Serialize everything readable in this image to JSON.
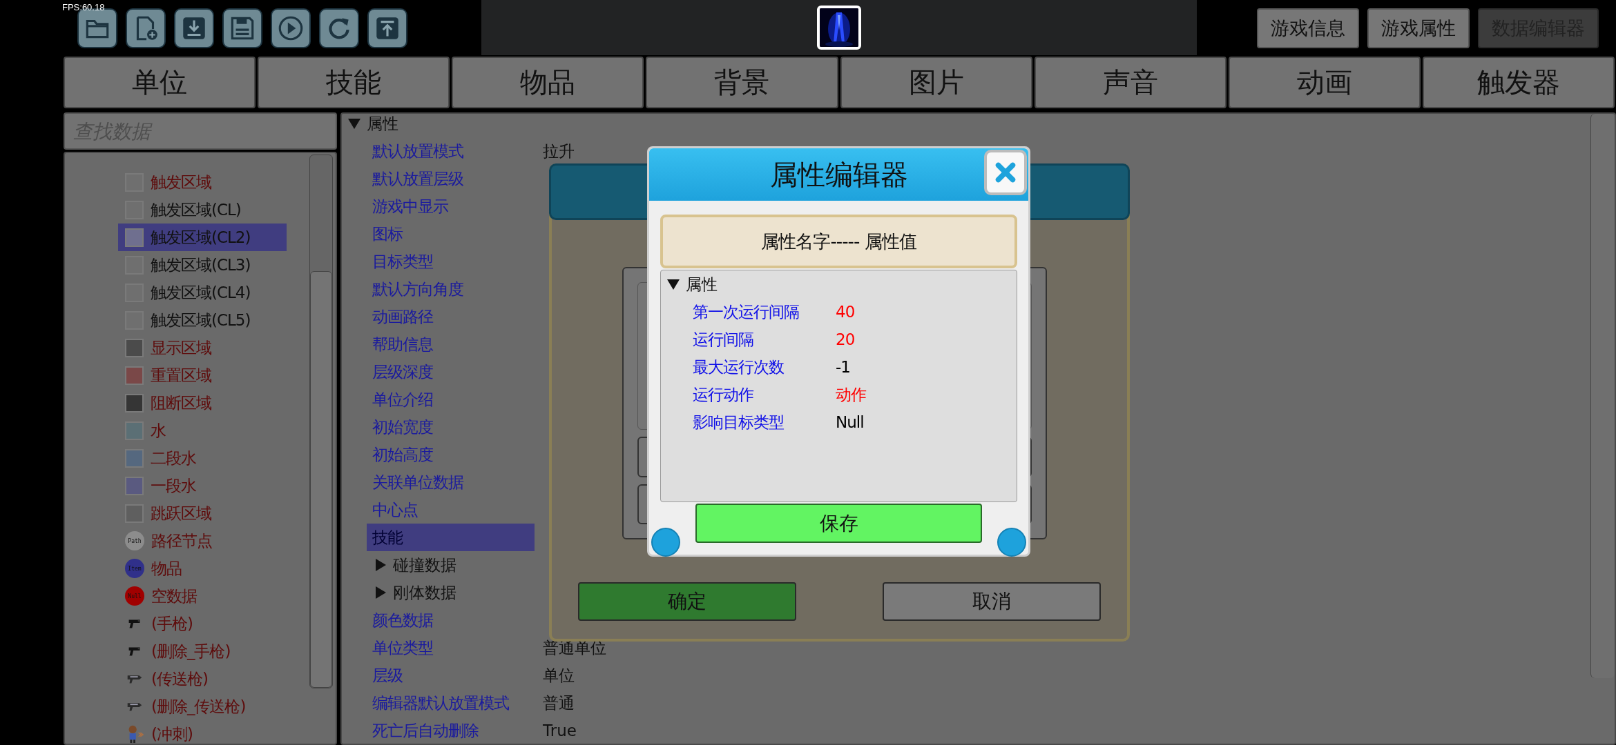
{
  "fps": "FPS:60.18",
  "top_buttons": [
    {
      "label": "游戏信息",
      "selected": false
    },
    {
      "label": "游戏属性",
      "selected": false
    },
    {
      "label": "数据编辑器",
      "selected": true
    }
  ],
  "tabs": [
    {
      "label": "单位"
    },
    {
      "label": "技能"
    },
    {
      "label": "物品"
    },
    {
      "label": "背景"
    },
    {
      "label": "图片"
    },
    {
      "label": "声音"
    },
    {
      "label": "动画"
    },
    {
      "label": "触发器"
    }
  ],
  "search": {
    "placeholder": "查找数据"
  },
  "data_list": [
    {
      "label": "触发区域",
      "kind": "swatch",
      "swatch": {
        "color": "#6f6f6f"
      },
      "color": "#5e0c0c",
      "selected": false
    },
    {
      "label": "触发区域(CL)",
      "kind": "swatch",
      "swatch": {
        "color": "#6f6f6f"
      },
      "color": "#111111",
      "selected": false
    },
    {
      "label": "触发区域(CL2)",
      "kind": "swatch",
      "swatch": {
        "color": "#6f6f8f"
      },
      "color": "#111111",
      "selected": true
    },
    {
      "label": "触发区域(CL3)",
      "kind": "swatch",
      "swatch": {
        "color": "#6f6f6f"
      },
      "color": "#111111",
      "selected": false
    },
    {
      "label": "触发区域(CL4)",
      "kind": "swatch",
      "swatch": {
        "color": "#6f6f6f"
      },
      "color": "#111111",
      "selected": false
    },
    {
      "label": "触发区域(CL5)",
      "kind": "swatch",
      "swatch": {
        "color": "#6f6f6f"
      },
      "color": "#111111",
      "selected": false
    },
    {
      "label": "显示区域",
      "kind": "swatch",
      "swatch": {
        "color": "#4b4b4b"
      },
      "color": "#5e0c0c",
      "selected": false
    },
    {
      "label": "重置区域",
      "kind": "swatch",
      "swatch": {
        "color": "#7a4848"
      },
      "color": "#5e0c0c",
      "selected": false
    },
    {
      "label": "阻断区域",
      "kind": "swatch",
      "swatch": {
        "color": "#353535"
      },
      "color": "#5e0c0c",
      "selected": false
    },
    {
      "label": "水",
      "kind": "swatch",
      "swatch": {
        "color": "#5b6f75"
      },
      "color": "#5e0c0c",
      "selected": false
    },
    {
      "label": "二段水",
      "kind": "swatch",
      "swatch": {
        "color": "#55687f"
      },
      "color": "#5e0c0c",
      "selected": false
    },
    {
      "label": "一段水",
      "kind": "swatch",
      "swatch": {
        "color": "#5a5a80"
      },
      "color": "#5e0c0c",
      "selected": false
    },
    {
      "label": "跳跃区域",
      "kind": "swatch",
      "swatch": {
        "color": "#5f5f5f"
      },
      "color": "#5e0c0c",
      "selected": false
    },
    {
      "label": "路径节点",
      "kind": "badge",
      "badge": {
        "label": "Path",
        "color": "#8c8c8c"
      },
      "color": "#5e0c0c",
      "selected": false
    },
    {
      "label": "物品",
      "kind": "badge",
      "badge": {
        "label": "Item",
        "color": "#30308a"
      },
      "color": "#5e0c0c",
      "selected": false
    },
    {
      "label": "空数据",
      "kind": "badge",
      "badge": {
        "label": "Null",
        "color": "#a00000"
      },
      "color": "#5e0c0c",
      "selected": false
    },
    {
      "label": "(手枪)",
      "kind": "pistol",
      "color": "#5e0c0c",
      "selected": false
    },
    {
      "label": "(删除_手枪)",
      "kind": "pistol",
      "color": "#5e0c0c",
      "selected": false
    },
    {
      "label": "(传送枪)",
      "kind": "blaster",
      "color": "#5e0c0c",
      "selected": false
    },
    {
      "label": "(删除_传送枪)",
      "kind": "blaster",
      "color": "#5e0c0c",
      "selected": false
    },
    {
      "label": "(冲刺)",
      "kind": "figure",
      "color": "#5e0c0c",
      "selected": false
    }
  ],
  "properties": {
    "label": "属性",
    "expanded": true,
    "items": [
      {
        "kind": "field",
        "label": "默认放置模式",
        "value": "拉升",
        "selected": false
      },
      {
        "kind": "field",
        "label": "默认放置层级",
        "selected": false
      },
      {
        "kind": "field",
        "label": "游戏中显示",
        "selected": false
      },
      {
        "kind": "field",
        "label": "图标",
        "selected": false
      },
      {
        "kind": "field",
        "label": "目标类型",
        "selected": false
      },
      {
        "kind": "field",
        "label": "默认方向角度",
        "selected": false
      },
      {
        "kind": "field",
        "label": "动画路径",
        "selected": false
      },
      {
        "kind": "field",
        "label": "帮助信息",
        "selected": false
      },
      {
        "kind": "field",
        "label": "层级深度",
        "selected": false
      },
      {
        "kind": "field",
        "label": "单位介绍",
        "selected": false
      },
      {
        "kind": "field",
        "label": "初始宽度",
        "selected": false
      },
      {
        "kind": "field",
        "label": "初始高度",
        "selected": false
      },
      {
        "kind": "field",
        "label": "关联单位数据",
        "selected": false
      },
      {
        "kind": "field",
        "label": "中心点",
        "selected": false
      },
      {
        "kind": "field",
        "label": "技能",
        "selected": true
      },
      {
        "kind": "group",
        "label": "碰撞数据",
        "expanded": false
      },
      {
        "kind": "group",
        "label": "刚体数据",
        "expanded": false
      },
      {
        "kind": "field",
        "label": "颜色数据",
        "selected": false
      },
      {
        "kind": "field",
        "label": "单位类型",
        "value": "普通单位",
        "selected": false
      },
      {
        "kind": "field",
        "label": "层级",
        "value": "单位",
        "selected": false
      },
      {
        "kind": "field",
        "label": "编辑器默认放置模式",
        "value": "普通",
        "selected": false
      },
      {
        "kind": "field",
        "label": "死亡后自动删除",
        "value": "True",
        "selected": false
      }
    ]
  },
  "back_dialog": {
    "buttons": [
      {
        "label": "确定",
        "kind": "confirm"
      },
      {
        "label": "取消",
        "kind": "cancel"
      }
    ]
  },
  "editor_dialog": {
    "title": "属性编辑器",
    "header": "属性名字----- 属性值",
    "tree": {
      "label": "属性",
      "expanded": true,
      "children": [
        {
          "label": "第一次运行间隔",
          "value": "40",
          "color": "#ff0000"
        },
        {
          "label": "运行间隔",
          "value": "20",
          "color": "#ff0000"
        },
        {
          "label": "最大运行次数",
          "value": "-1",
          "color": "#000000"
        },
        {
          "label": "运行动作",
          "value": "动作",
          "color": "#ff0000"
        },
        {
          "label": "影响目标类型",
          "value": "Null",
          "color": "#000000"
        }
      ]
    },
    "save_button": "保存"
  }
}
